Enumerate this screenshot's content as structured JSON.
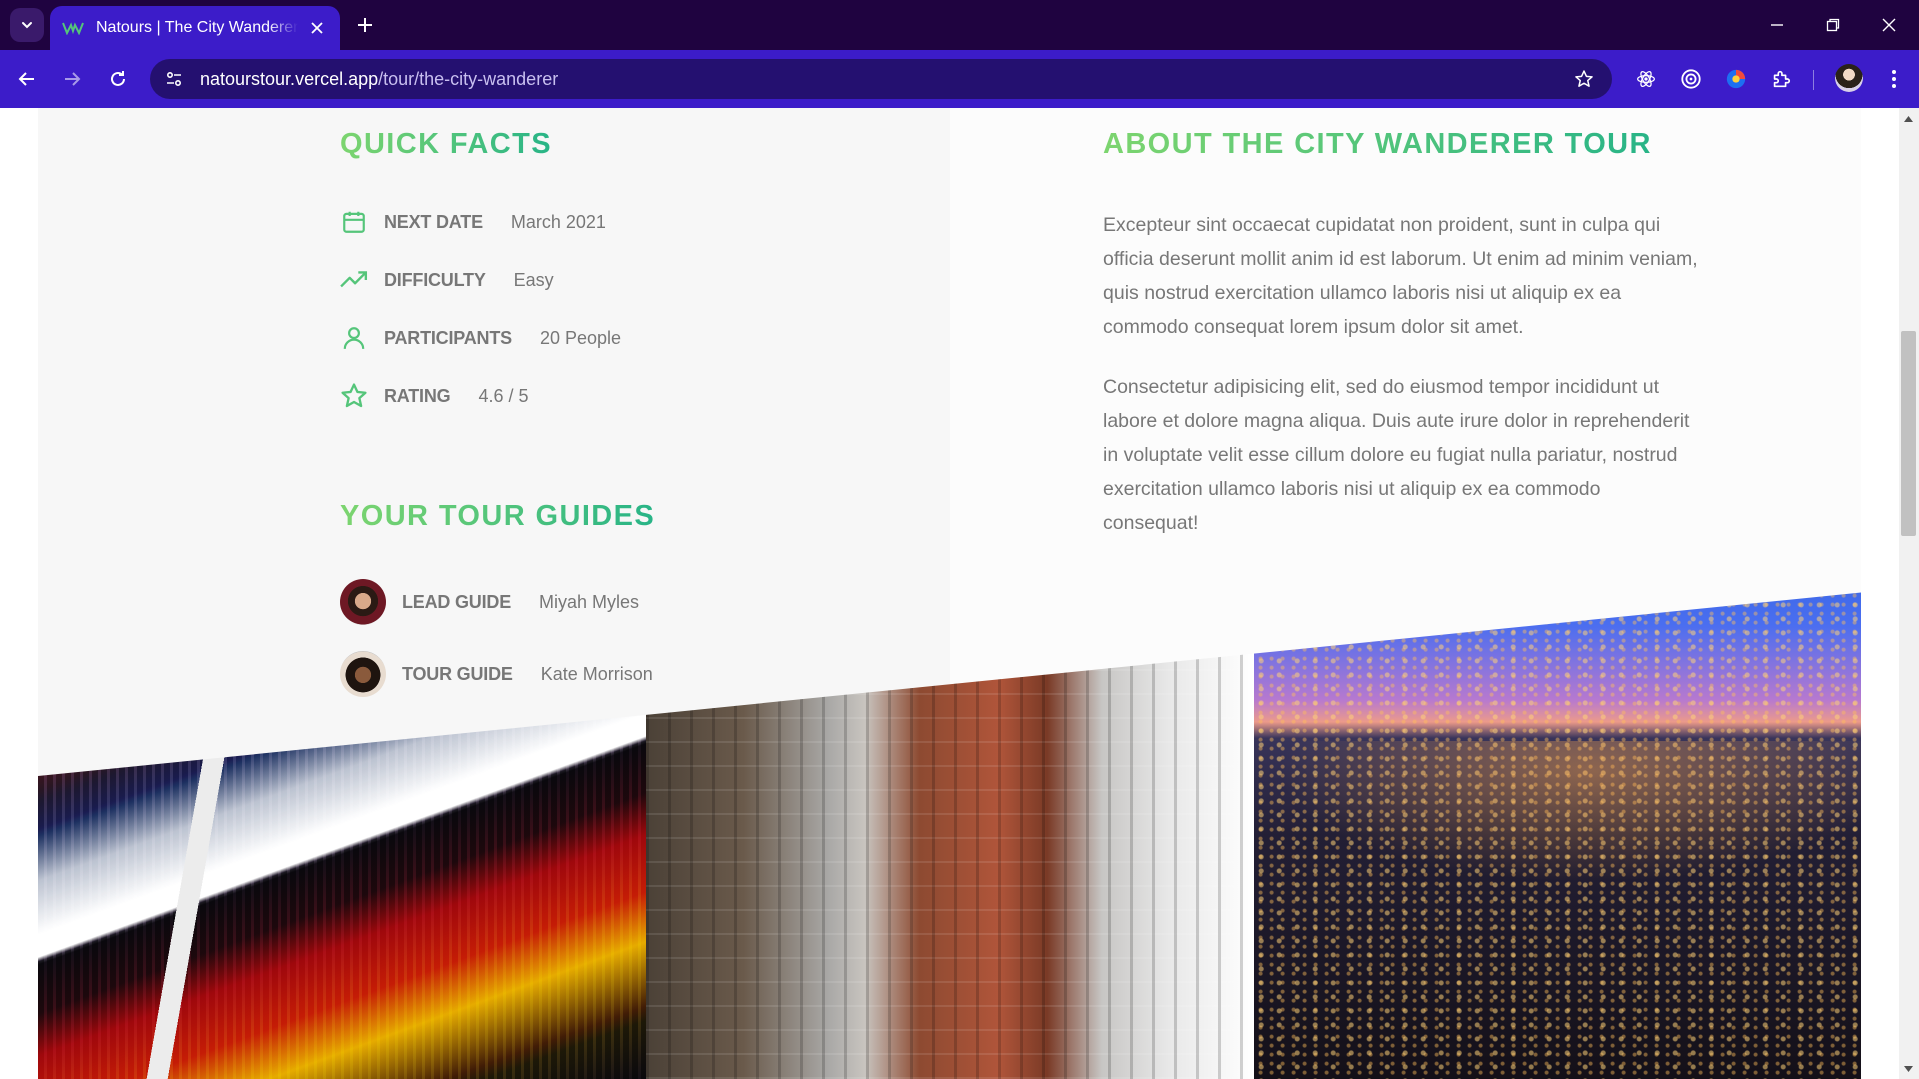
{
  "browser": {
    "tab_title": "Natours | The City Wanderer Tour",
    "url_host": "natourstour.vercel.app",
    "url_path": "/tour/the-city-wanderer",
    "accent": "#3c1cc9",
    "frame": "#1f0340"
  },
  "quick_facts": {
    "heading": "QUICK FACTS",
    "items": [
      {
        "icon": "calendar-icon",
        "label": "NEXT DATE",
        "value": "March 2021"
      },
      {
        "icon": "trending-up-icon",
        "label": "DIFFICULTY",
        "value": "Easy"
      },
      {
        "icon": "user-icon",
        "label": "PARTICIPANTS",
        "value": "20 People"
      },
      {
        "icon": "star-icon",
        "label": "RATING",
        "value": "4.6 / 5"
      }
    ]
  },
  "guides": {
    "heading": "YOUR TOUR GUIDES",
    "items": [
      {
        "label": "LEAD GUIDE",
        "name": "Miyah Myles"
      },
      {
        "label": "TOUR GUIDE",
        "name": "Kate Morrison"
      }
    ]
  },
  "about": {
    "heading": "ABOUT THE CITY WANDERER TOUR",
    "paragraphs": [
      "Excepteur sint occaecat cupidatat non proident, sunt in culpa qui officia deserunt mollit anim id est laborum. Ut enim ad minim veniam, quis nostrud exercitation ullamco laboris nisi ut aliquip ex ea commodo consequat lorem ipsum dolor sit amet.",
      "Consectetur adipisicing elit, sed do eiusmod tempor incididunt ut labore et dolore magna aliqua. Duis aute irure dolor in reprehenderit in voluptate velit esse cillum dolore eu fugiat nulla pariatur, nostrud exercitation ullamco laboris nisi ut aliquip ex ea commodo consequat!"
    ]
  },
  "colors": {
    "green_light": "#7dd56f",
    "green_dark": "#28b487",
    "text_grey": "#777777"
  }
}
